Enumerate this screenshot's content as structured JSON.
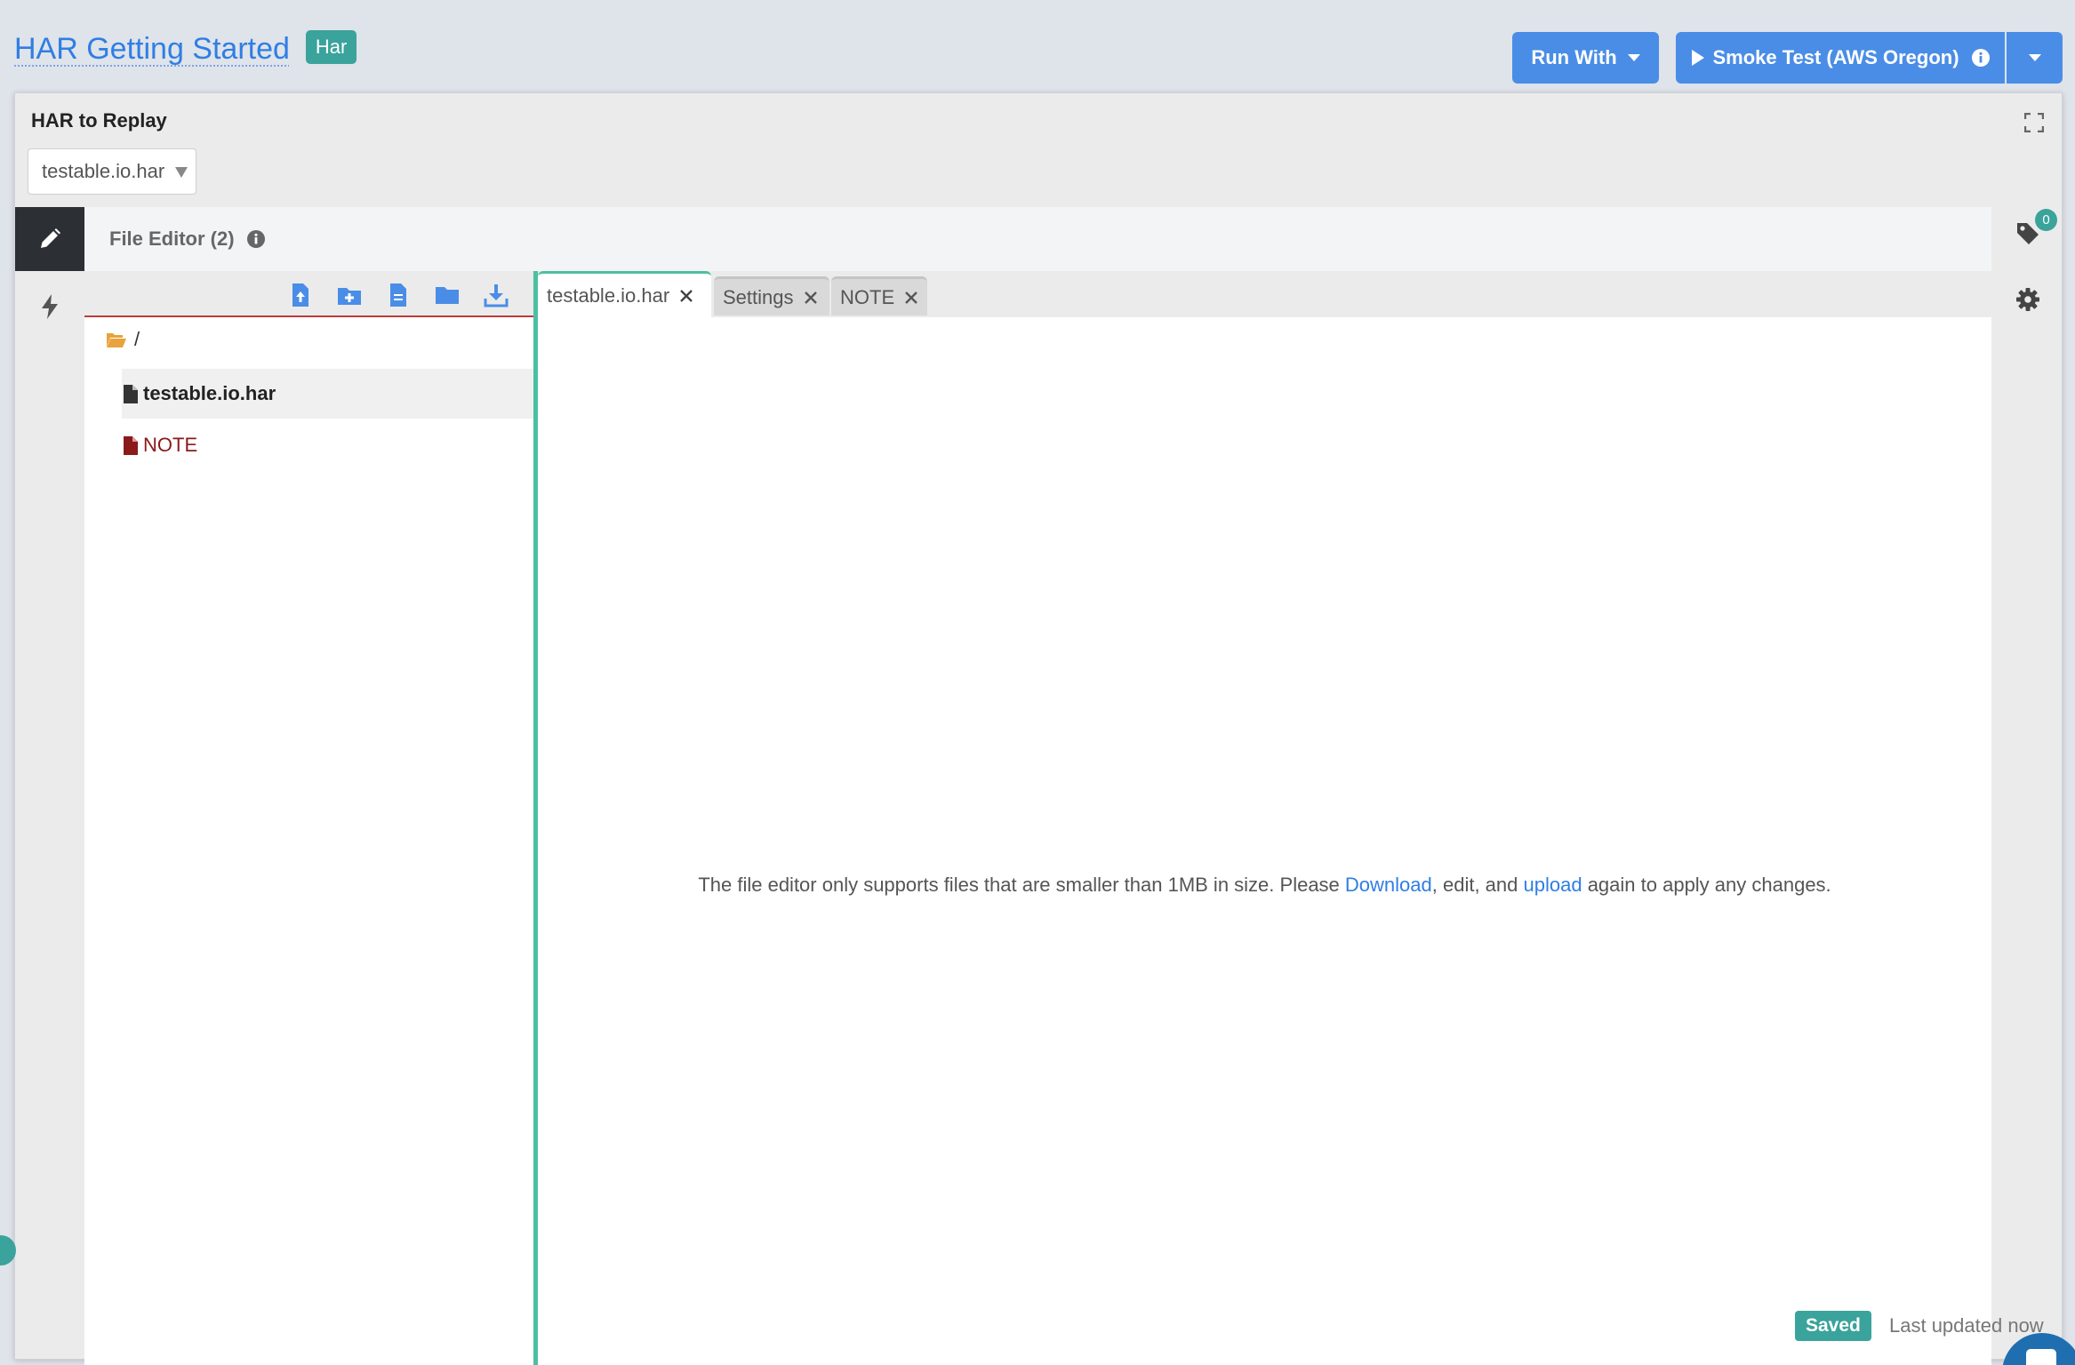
{
  "header": {
    "title": "HAR Getting Started",
    "type_badge": "Har",
    "run_with_label": "Run With",
    "smoke_test_label": "Smoke Test (AWS Oregon)"
  },
  "panel": {
    "heading": "HAR to Replay",
    "har_select_value": "testable.io.har"
  },
  "editor": {
    "title": "File Editor (2)",
    "tag_count": "0",
    "tree": {
      "root": "/",
      "files": [
        {
          "name": "testable.io.har"
        },
        {
          "name": "NOTE"
        }
      ]
    },
    "tabs": [
      {
        "label": "testable.io.har"
      },
      {
        "label": "Settings"
      },
      {
        "label": "NOTE"
      }
    ],
    "message": {
      "before": "The file editor only supports files that are smaller than 1MB in size. Please ",
      "download_link": "Download",
      "middle": ", edit, and ",
      "upload_link": "upload",
      "after": " again to apply any changes."
    }
  },
  "footer": {
    "saved_label": "Saved",
    "last_updated": "Last updated now"
  },
  "colors": {
    "accent_blue": "#4a8de6",
    "link_blue": "#2f7ee3",
    "teal": "#3aa39b",
    "note_red": "#8b1a1a"
  },
  "icons": {
    "toolbar": [
      "upload-file-icon",
      "new-folder-icon",
      "new-file-icon",
      "folder-icon",
      "download-icon"
    ],
    "sidebar_left": [
      "pencil-icon",
      "bolt-icon"
    ],
    "sidebar_right": [
      "tag-icon",
      "gear-icon"
    ]
  }
}
